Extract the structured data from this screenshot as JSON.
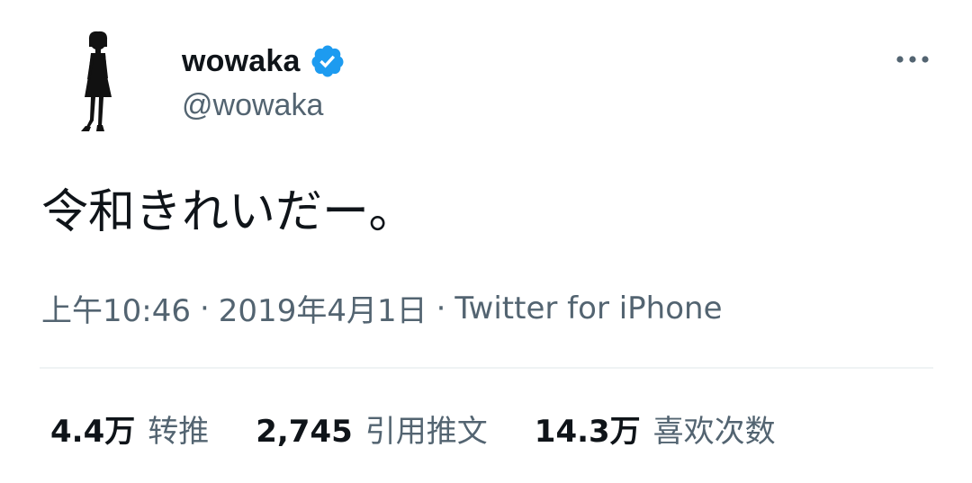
{
  "author": {
    "display_name": "wowaka",
    "handle": "@wowaka",
    "verified": true,
    "avatar_icon": "silhouette-figure-icon",
    "verified_icon": "verified-badge-icon",
    "verified_color": "#1d9bf0"
  },
  "menu": {
    "more_icon": "more-horizontal-icon"
  },
  "tweet": {
    "text": "令和きれいだー。"
  },
  "meta": {
    "time": "上午10:46",
    "separator": "·",
    "date": "2019年4月1日",
    "source": "Twitter for iPhone"
  },
  "stats": [
    {
      "value": "4.4万",
      "label": "转推"
    },
    {
      "value": "2,745",
      "label": "引用推文"
    },
    {
      "value": "14.3万",
      "label": "喜欢次数"
    }
  ],
  "colors": {
    "text_primary": "#0f1419",
    "text_secondary": "#536471",
    "divider": "#eff3f4",
    "background": "#ffffff"
  }
}
